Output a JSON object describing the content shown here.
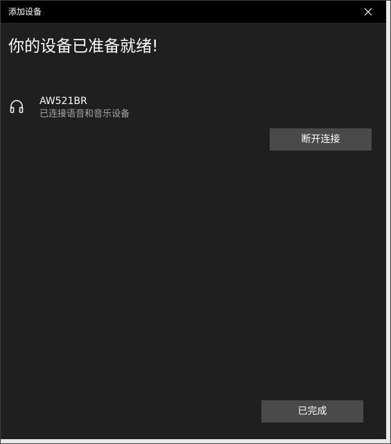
{
  "window": {
    "title": "添加设备"
  },
  "main": {
    "heading": "你的设备已准备就绪!"
  },
  "device": {
    "icon": "headphones-icon",
    "name": "AW521BR",
    "status": "已连接语音和音乐设备"
  },
  "buttons": {
    "disconnect_label": "断开连接",
    "done_label": "已完成"
  },
  "colors": {
    "background": "#1f1f1f",
    "titlebar": "#000000",
    "button": "#4a4a4a",
    "secondary_text": "#a6a6a6"
  }
}
